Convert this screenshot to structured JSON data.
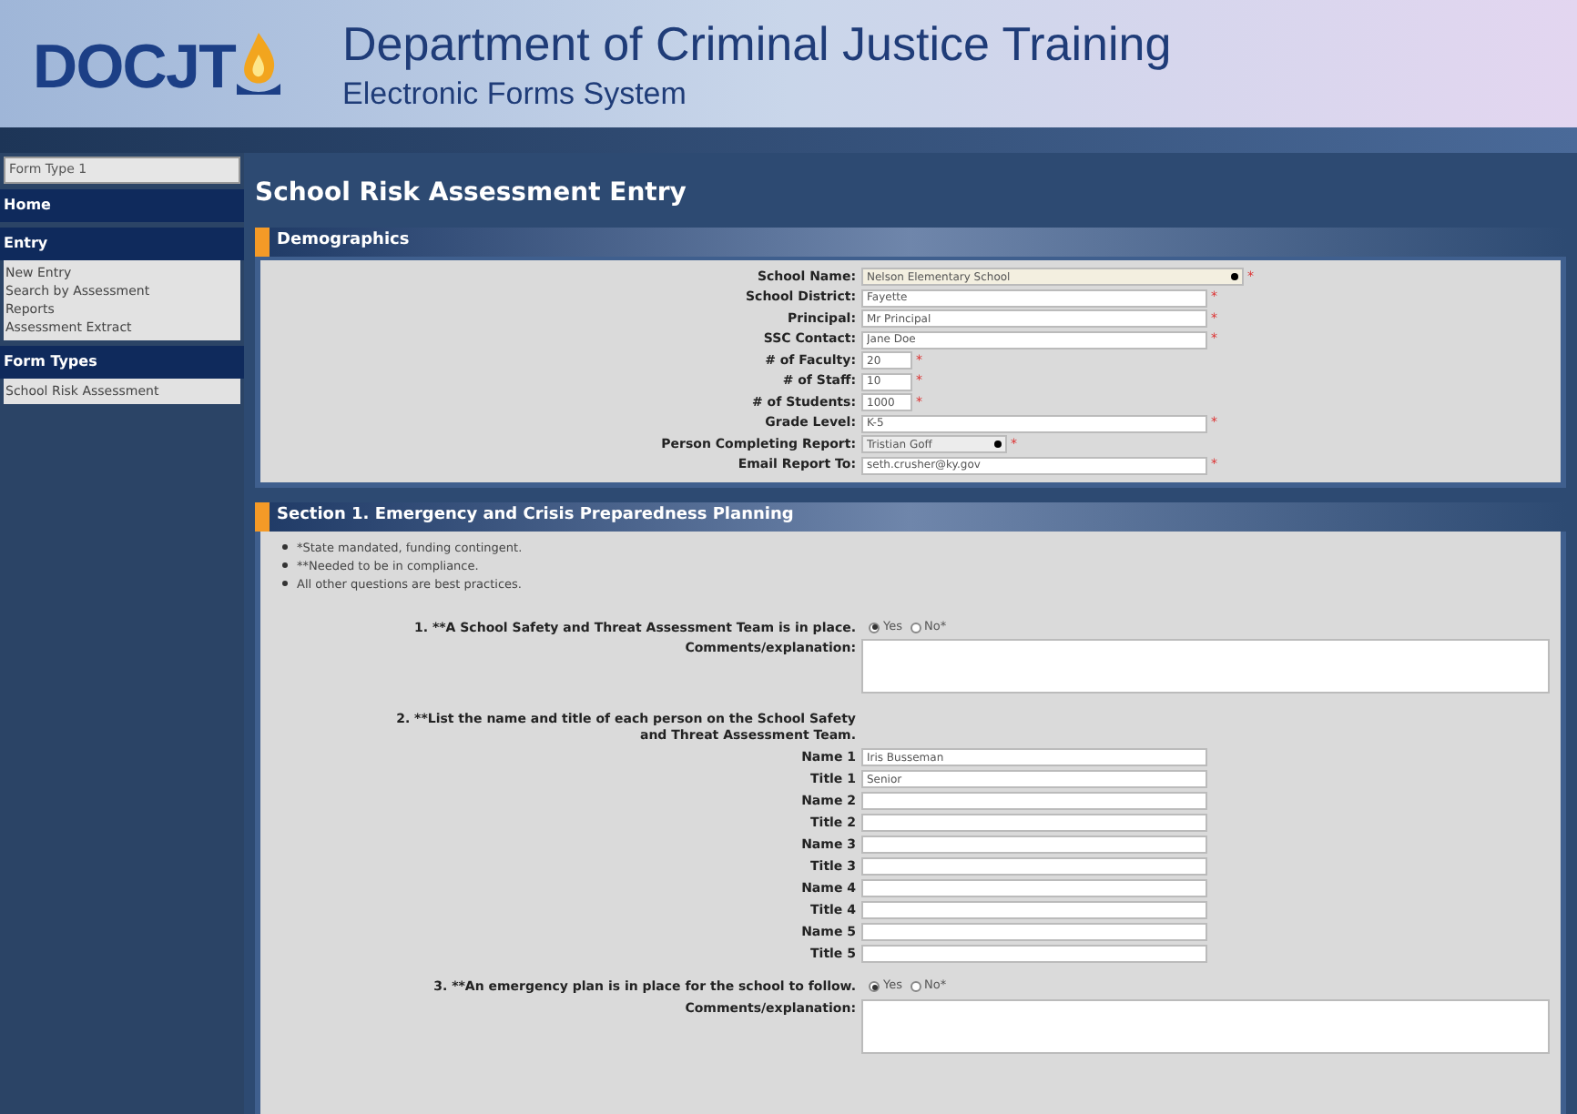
{
  "header": {
    "logo": "DOCJT",
    "title": "Department of Criminal Justice Training",
    "subtitle": "Electronic Forms System"
  },
  "sidebar": {
    "form_type": "Form Type 1",
    "sections": [
      {
        "title": "Home"
      },
      {
        "title": "Entry",
        "items": [
          "New Entry",
          "Search by Assessment",
          "Reports",
          "Assessment Extract"
        ]
      },
      {
        "title": "Form Types",
        "items": [
          "School Risk Assessment"
        ]
      }
    ]
  },
  "page_title": "School Risk Assessment Entry",
  "demographics": {
    "title": "Demographics",
    "fields": [
      {
        "label": "School Name:",
        "kind": "select",
        "value": "Nelson Elementary School",
        "mark": "*"
      },
      {
        "label": "School District:",
        "kind": "text",
        "value": "Fayette",
        "mark": "*"
      },
      {
        "label": "Principal:",
        "kind": "text",
        "value": "Mr Principal",
        "mark": "*"
      },
      {
        "label": "SSC Contact:",
        "kind": "text",
        "value": "Jane Doe",
        "mark": "*"
      },
      {
        "label": "# of Faculty:",
        "kind": "short",
        "value": "20",
        "mark": "*"
      },
      {
        "label": "# of Staff:",
        "kind": "short",
        "value": "10",
        "mark": "*"
      },
      {
        "label": "# of Students:",
        "kind": "short",
        "value": "1000",
        "mark": "*"
      },
      {
        "label": "Grade Level:",
        "kind": "text",
        "value": "K-5",
        "mark": "*"
      },
      {
        "label": "Person Completing Report:",
        "kind": "select",
        "value": "Tristian Goff",
        "mark": "*"
      },
      {
        "label": "Email Report To:",
        "kind": "text",
        "value": "seth.crusher@ky.gov",
        "mark": "*"
      }
    ]
  },
  "section1": {
    "title": "Section 1. Emergency and Crisis Preparedness Planning",
    "notes": [
      "*State mandated, funding contingent.",
      "**Needed to be in compliance.",
      "All other questions are best practices."
    ],
    "questions": [
      {
        "kind": "radio",
        "text": "1. **A School Safety and Threat Assessment Team is in place.",
        "options": [
          {
            "label": "Yes",
            "selected": true
          },
          {
            "label": "No*",
            "selected": false
          }
        ],
        "comments_label": "Comments/explanation:"
      },
      {
        "kind": "list",
        "text": "2. **List the name and title of each person on the School Safety and Threat Assessment Team.",
        "fields": [
          {
            "label": "Name 1",
            "value": "Iris Busseman"
          },
          {
            "label": "Title 1",
            "value": "Senior"
          },
          {
            "label": "Name 2"
          },
          {
            "label": "Title 2"
          },
          {
            "label": "Name 3"
          },
          {
            "label": "Title 3"
          },
          {
            "label": "Name 4"
          },
          {
            "label": "Title 4"
          },
          {
            "label": "Name 5"
          },
          {
            "label": "Title 5"
          }
        ]
      },
      {
        "kind": "radio",
        "text": "3. **An emergency plan is in place for the school to follow.",
        "options": [
          {
            "label": "Yes",
            "selected": true
          },
          {
            "label": "No*",
            "selected": false
          }
        ],
        "comments_label": "Comments/explanation:"
      }
    ]
  }
}
